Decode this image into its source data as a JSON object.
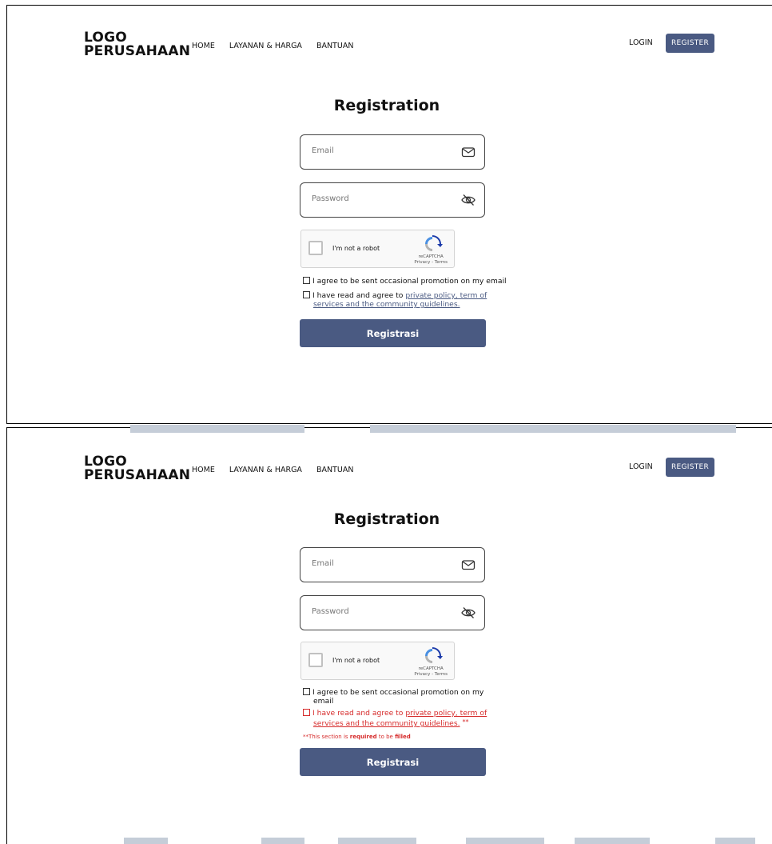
{
  "header": {
    "logo": "LOGO\nPERUSAHAAN",
    "logo_line1": "LOGO",
    "logo_line2": "PERUSAHAAN",
    "nav": [
      "HOME",
      "LAYANAN & HARGA",
      "BANTUAN"
    ],
    "login": "LOGIN",
    "register": "REGISTER"
  },
  "form": {
    "title": "Registration",
    "email_placeholder": "Email",
    "password_placeholder": "Password",
    "captcha_label": "I'm not a robot",
    "captcha_brand": "reCAPTCHA",
    "captcha_links": "Privacy - Terms",
    "promo_check": "I agree to be sent  occasional promotion on my email",
    "promo_check_part1": "I agree to be sent  occasional promotion on my",
    "promo_check_part2": "email",
    "terms_prefix": "I have read and agree to ",
    "terms_link_line1": "private policy, term of",
    "terms_link_line2": "services and the community guidelines.",
    "error_marker": "**",
    "error_prefix": "**This section is ",
    "error_required": "required",
    "error_middle": " to be ",
    "error_filled": "filled",
    "submit": "Registrasi"
  },
  "colors": {
    "accent": "#4a5a82",
    "error": "#d62b2b"
  }
}
